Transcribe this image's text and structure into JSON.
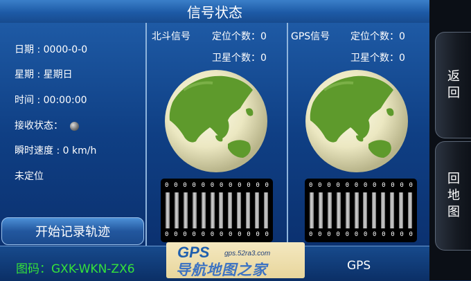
{
  "header": {
    "title": "信号状态"
  },
  "info": {
    "date_label": "日期",
    "date_value": "0000-0-0",
    "weekday_label": "星期",
    "weekday_value": "星期日",
    "time_label": "时间",
    "time_value": "00:00:00",
    "receive_label": "接收状态：",
    "speed_label": "瞬时速度",
    "speed_value": "0 km/h",
    "fix_status": "未定位"
  },
  "record_button": "开始记录轨迹",
  "beidou": {
    "label": "北斗信号",
    "fix_count": "定位个数：0",
    "sat_count": "卫星个数：0",
    "digits": [
      "0",
      "0",
      "0",
      "0",
      "0",
      "0",
      "0",
      "0",
      "0",
      "0",
      "0",
      "0"
    ]
  },
  "gps": {
    "label": "GPS信号",
    "fix_count": "定位个数：0",
    "sat_count": "卫星个数：0",
    "digits": [
      "0",
      "0",
      "0",
      "0",
      "0",
      "0",
      "0",
      "0",
      "0",
      "0",
      "0",
      "0"
    ]
  },
  "side": {
    "back": "返回",
    "home_map": "回地图"
  },
  "footer": {
    "map_code": "图码：GXK-WKN-ZX6",
    "mode": "GPS"
  },
  "watermark": {
    "brand": "GPS",
    "url": "gps.52ra3.com",
    "name": "导航地图之家"
  },
  "colors": {
    "accent_green": "#35e23a",
    "title_blue": "#1d5aa6"
  }
}
